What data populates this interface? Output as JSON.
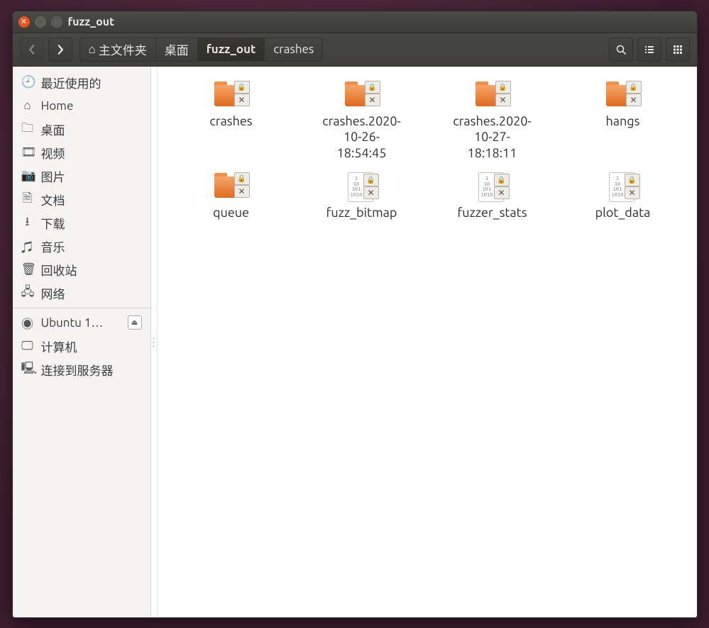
{
  "window": {
    "title": "fuzz_out"
  },
  "breadcrumbs": [
    {
      "label": "主文件夹",
      "home": true
    },
    {
      "label": "桌面"
    },
    {
      "label": "fuzz_out",
      "active": true
    },
    {
      "label": "crashes"
    }
  ],
  "sidebar": {
    "places": [
      {
        "name": "最近使用的",
        "icon": "🕘"
      },
      {
        "name": "Home",
        "icon": "⌂"
      },
      {
        "name": "桌面",
        "icon": "🗀"
      },
      {
        "name": "视频",
        "icon": "🎞"
      },
      {
        "name": "图片",
        "icon": "📷"
      },
      {
        "name": "文档",
        "icon": "🗎"
      },
      {
        "name": "下载",
        "icon": "⭳"
      },
      {
        "name": "音乐",
        "icon": "♫"
      },
      {
        "name": "回收站",
        "icon": "🗑"
      },
      {
        "name": "网络",
        "icon": "🖧"
      }
    ],
    "devices": [
      {
        "name": "Ubuntu 1…",
        "icon": "◉",
        "eject": true
      },
      {
        "name": "计算机",
        "icon": "🖵"
      },
      {
        "name": "连接到服务器",
        "icon": "🖳"
      }
    ]
  },
  "files": [
    {
      "name": "crashes",
      "type": "folder-locked"
    },
    {
      "name": "crashes.2020-\n10-26-\n18:54:45",
      "type": "folder-locked"
    },
    {
      "name": "crashes.2020-\n10-27-\n18:18:11",
      "type": "folder-locked"
    },
    {
      "name": "hangs",
      "type": "folder-locked"
    },
    {
      "name": "queue",
      "type": "folder-locked"
    },
    {
      "name": "fuzz_bitmap",
      "type": "binary-locked"
    },
    {
      "name": "fuzzer_stats",
      "type": "binary-locked"
    },
    {
      "name": "plot_data",
      "type": "binary-locked"
    }
  ]
}
